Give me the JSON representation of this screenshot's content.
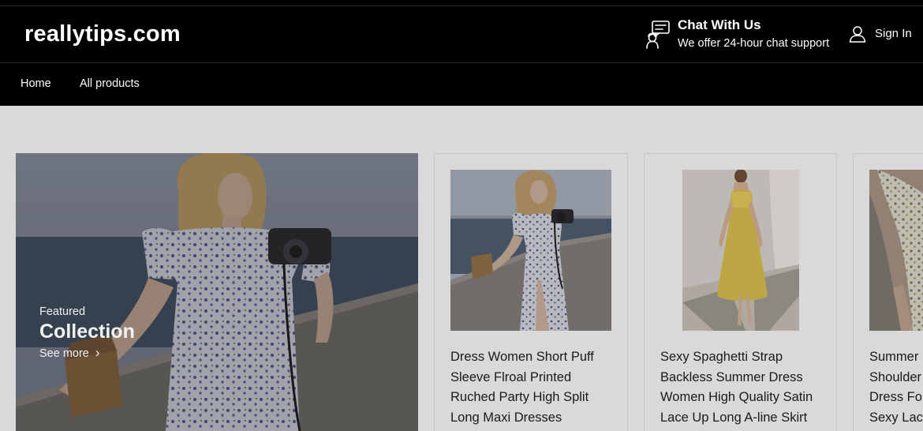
{
  "header": {
    "logo": "reallytips.com",
    "chat_title": "Chat With Us",
    "chat_subtitle": "We offer 24-hour chat support",
    "signin_label": "Sign In"
  },
  "nav": {
    "items": [
      "Home",
      "All products"
    ]
  },
  "hero": {
    "kicker": "Featured",
    "heading": "Collection",
    "link_label": "See more"
  },
  "products": [
    {
      "title": "Dress Women Short Puff Sleeve Flroal Printed Ruched Party High Split Long Maxi Dresses"
    },
    {
      "title": "Sexy Spaghetti Strap Backless Summer Dress Women High Quality Satin Lace Up Long A-line Skirt"
    },
    {
      "title": "Summer Shoulder Dress For Sexy Lace"
    }
  ],
  "colors": {
    "header_bg": "#000000",
    "page_bg": "#d9d9d9",
    "text_dark": "#1a1a1a"
  },
  "icons": [
    "chat-support-icon",
    "user-icon",
    "chevron-right-icon"
  ]
}
